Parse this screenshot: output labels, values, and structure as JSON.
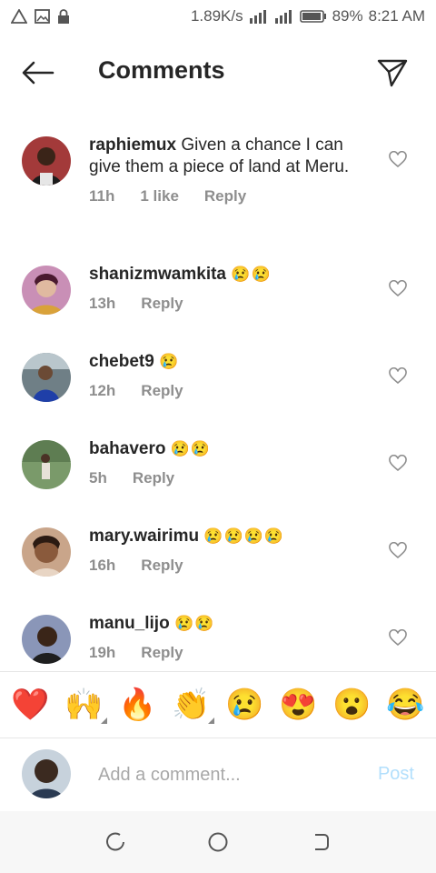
{
  "status_bar": {
    "net_speed": "1.89K/s",
    "battery": "89%",
    "time": "8:21 AM"
  },
  "header": {
    "title": "Comments"
  },
  "comments": [
    {
      "username": "raphiemux",
      "text": "Given a chance I can give them a piece of land at Meru.",
      "emojis": "",
      "time": "11h",
      "likes": "1 like",
      "reply": "Reply"
    },
    {
      "username": "shanizmwamkita",
      "text": "",
      "emojis": "😢😢",
      "time": "13h",
      "likes": "",
      "reply": "Reply"
    },
    {
      "username": "chebet9",
      "text": "",
      "emojis": "😢",
      "time": "12h",
      "likes": "",
      "reply": "Reply"
    },
    {
      "username": "bahavero",
      "text": "",
      "emojis": "😢😢",
      "time": "5h",
      "likes": "",
      "reply": "Reply"
    },
    {
      "username": "mary.wairimu",
      "text": "",
      "emojis": "😢😢😢😢",
      "time": "16h",
      "likes": "",
      "reply": "Reply"
    },
    {
      "username": "manu_lijo",
      "text": "",
      "emojis": "😢😢",
      "time": "19h",
      "likes": "",
      "reply": "Reply"
    }
  ],
  "emoji_bar": [
    "❤️",
    "🙌",
    "🔥",
    "👏",
    "😢",
    "😍",
    "😮",
    "😂"
  ],
  "composer": {
    "placeholder": "Add a comment...",
    "post_label": "Post"
  },
  "colors": {
    "text": "#262626",
    "meta": "#8e8e8e",
    "post_disabled": "#b2dffc",
    "divider": "#e6e6e6"
  }
}
